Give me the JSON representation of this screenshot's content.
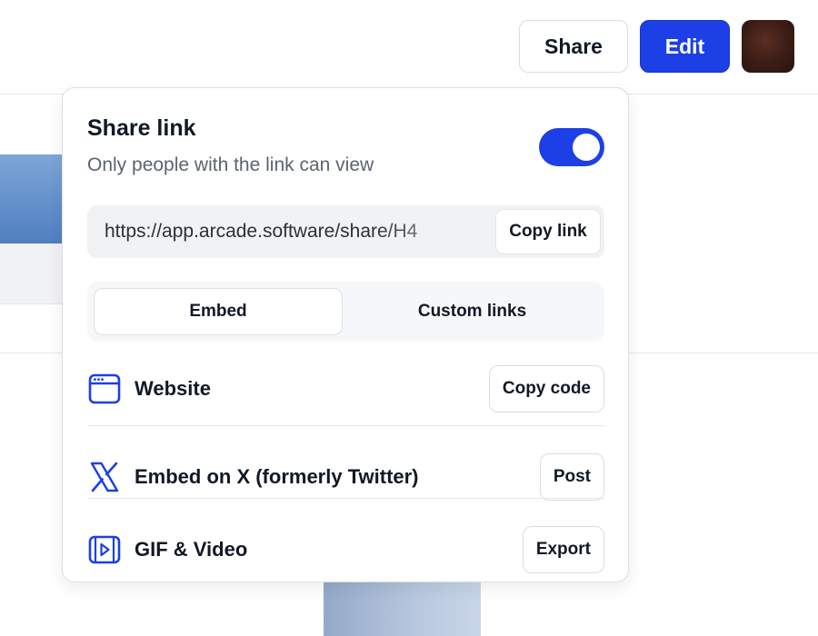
{
  "header": {
    "share_label": "Share",
    "edit_label": "Edit"
  },
  "share_popover": {
    "title": "Share link",
    "subtitle": "Only people with the link can view",
    "toggle_on": true,
    "url": "https://app.arcade.software/share/H4",
    "copy_link_label": "Copy link",
    "tabs": [
      {
        "label": "Embed",
        "active": true
      },
      {
        "label": "Custom links",
        "active": false
      }
    ],
    "options": [
      {
        "icon": "browser-window-icon",
        "label": "Website",
        "action": "Copy code"
      },
      {
        "icon": "x-logo-icon",
        "label": "Embed on X (formerly Twitter)",
        "action": "Post"
      },
      {
        "icon": "video-play-icon",
        "label": "GIF & Video",
        "action": "Export"
      }
    ]
  },
  "colors": {
    "accent": "#1d3fe6",
    "text": "#111827",
    "muted": "#5b6472"
  }
}
